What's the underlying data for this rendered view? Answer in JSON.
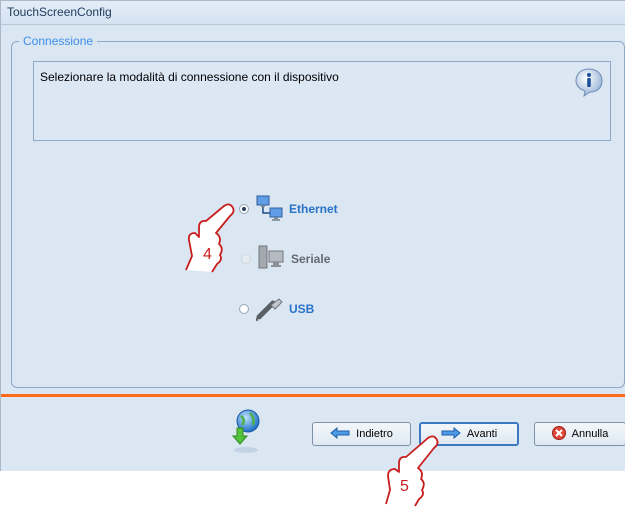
{
  "window": {
    "title": "TouchScreenConfig"
  },
  "group": {
    "legend": "Connessione"
  },
  "info": {
    "text": "Selezionare la modalità di connessione con il dispositivo",
    "icon": "info-icon"
  },
  "options": [
    {
      "label": "Ethernet",
      "selected": true,
      "enabled": true,
      "icon": "network-computer-icon"
    },
    {
      "label": "Seriale",
      "selected": false,
      "enabled": false,
      "icon": "serial-computer-icon"
    },
    {
      "label": "USB",
      "selected": false,
      "enabled": true,
      "icon": "usb-plug-icon"
    }
  ],
  "buttons": {
    "back": "Indietro",
    "next": "Avanti",
    "cancel": "Annulla"
  },
  "callouts": {
    "first": "4",
    "second": "5"
  },
  "colors": {
    "accent": "#3b8ee8",
    "separator": "#ff6a1a",
    "callout": "#c81e1e"
  }
}
